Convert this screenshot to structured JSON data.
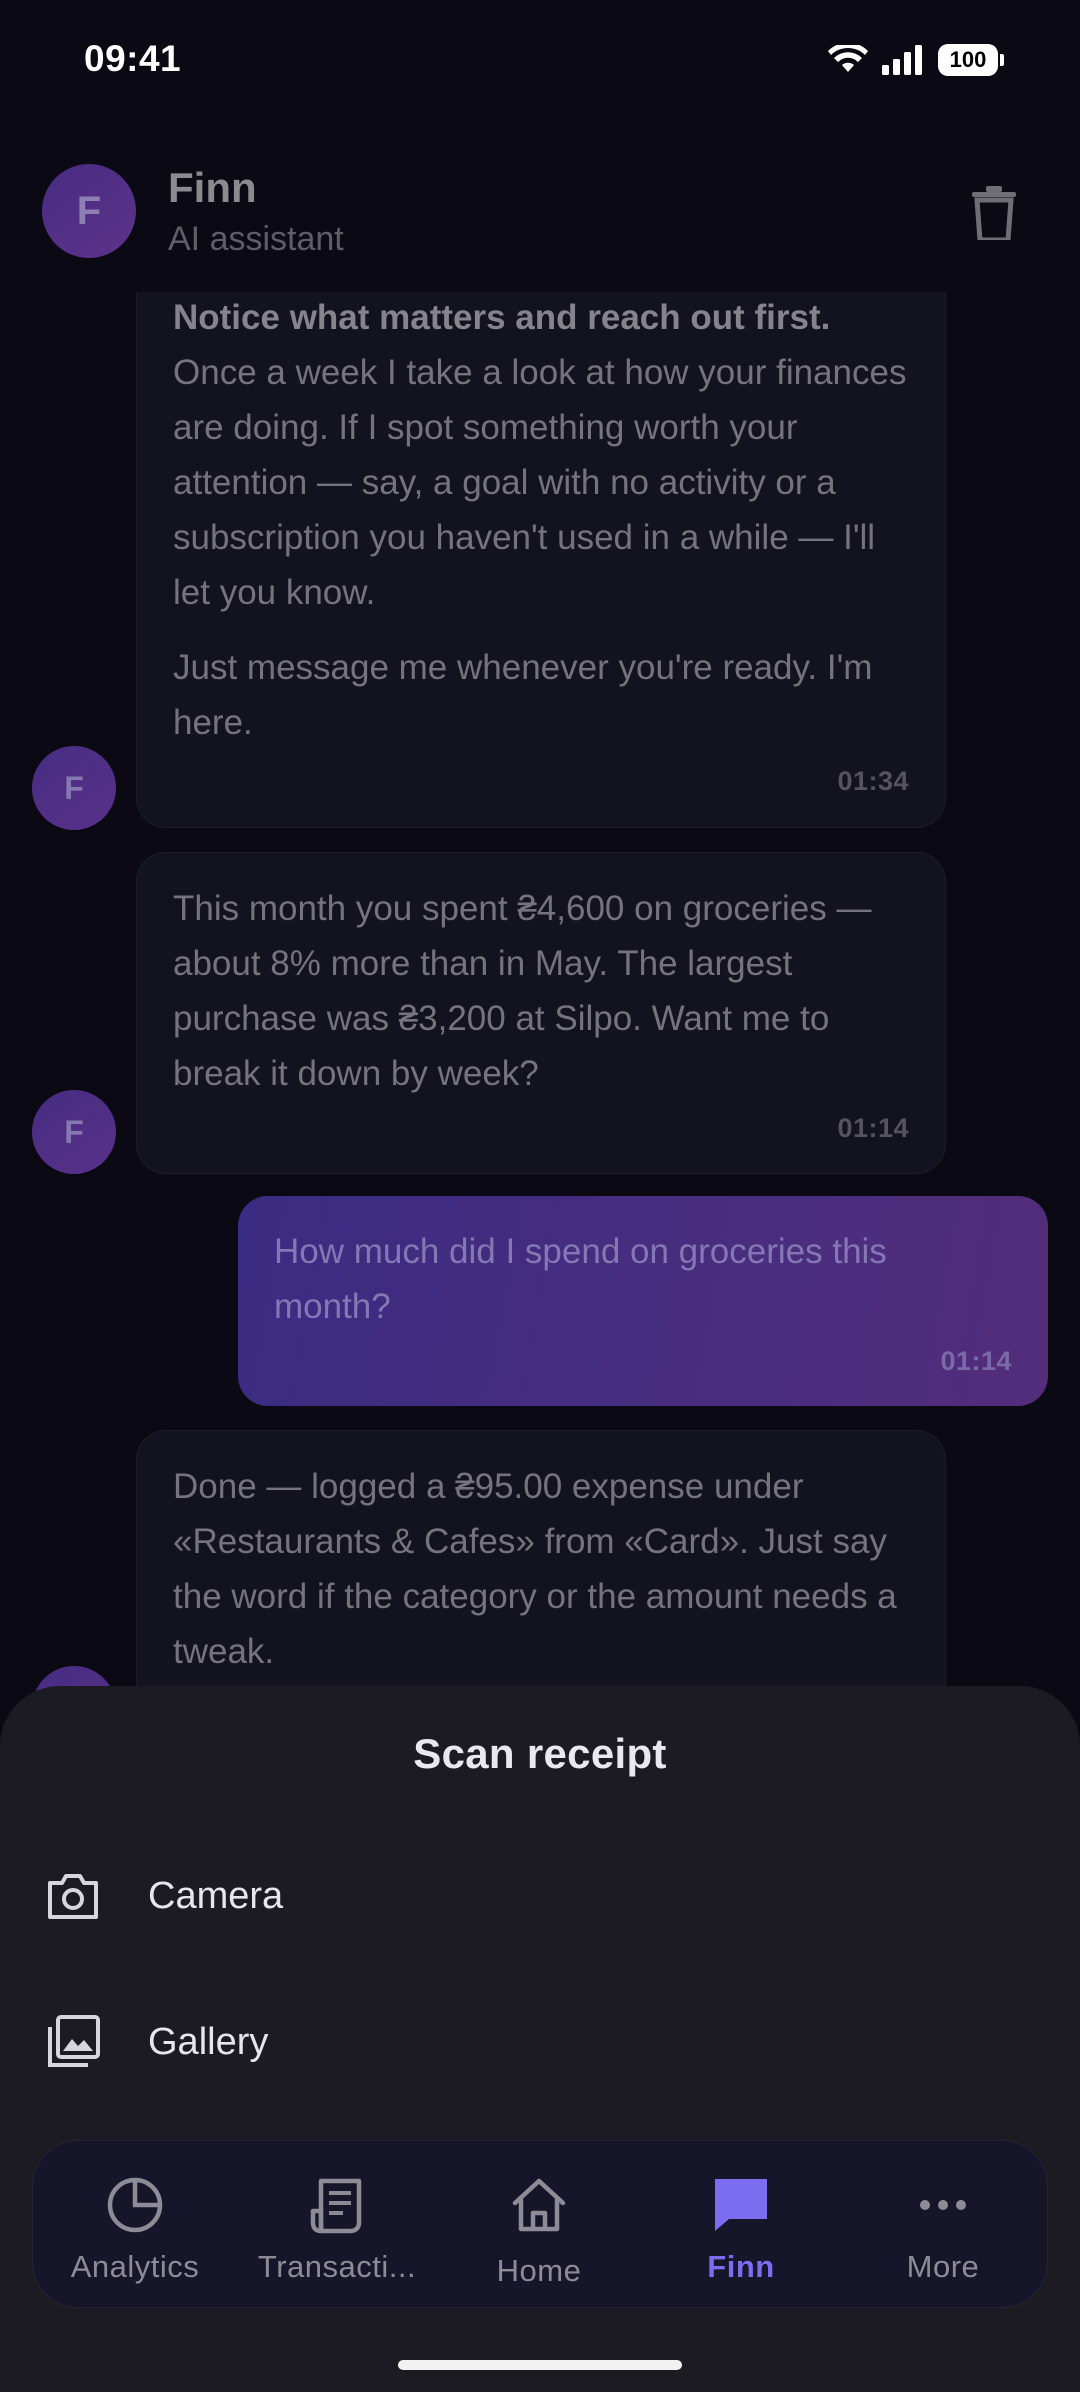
{
  "status_bar": {
    "time": "09:41",
    "battery": "100"
  },
  "header": {
    "avatar_letter": "F",
    "name": "Finn",
    "subtitle": "AI assistant"
  },
  "messages": [
    {
      "sender": "assistant",
      "bold_text": "Notice what matters and reach out first.",
      "text": "Once a week I take a look at how your finances are doing. If I spot something worth your attention — say, a goal with no activity or a subscription you haven't used in a while — I'll let you know.",
      "text2": "Just message me whenever you're ready. I'm here.",
      "time": "01:34",
      "avatar_letter": "F"
    },
    {
      "sender": "assistant",
      "text": "This month you spent ₴4,600 on groceries — about 8% more than in May. The largest purchase was ₴3,200 at Silpo. Want me to break it down by week?",
      "time": "01:14",
      "avatar_letter": "F"
    },
    {
      "sender": "user",
      "text": "How much did I spend on groceries this month?",
      "time": "01:14"
    },
    {
      "sender": "assistant",
      "text": "Done — logged a ₴95.00 expense under «Restaurants & Cafes» from «Card». Just say the word if the category or the amount needs a tweak.",
      "avatar_letter": "F"
    }
  ],
  "sheet": {
    "title": "Scan receipt",
    "options": [
      {
        "label": "Camera",
        "icon": "camera-icon"
      },
      {
        "label": "Gallery",
        "icon": "gallery-icon"
      }
    ]
  },
  "nav": {
    "items": [
      {
        "label": "Analytics",
        "icon": "analytics-icon"
      },
      {
        "label": "Transacti...",
        "icon": "receipt-icon"
      },
      {
        "label": "Home",
        "icon": "home-icon"
      },
      {
        "label": "Finn",
        "icon": "chat-icon",
        "active": true
      },
      {
        "label": "More",
        "icon": "more-icon"
      }
    ]
  },
  "colors": {
    "background": "#0b0a14",
    "accent": "#7b6cf0",
    "sheet": "#1c1b22",
    "user_bubble": "#492d7e"
  }
}
